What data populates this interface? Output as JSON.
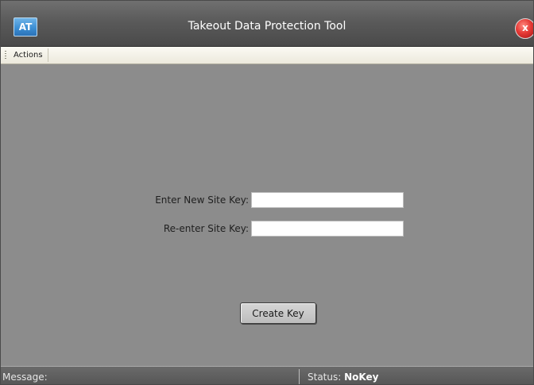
{
  "window": {
    "title": "Takeout Data Protection Tool",
    "logo_text": "AT",
    "close_label": "x"
  },
  "menu": {
    "items": [
      {
        "label": "Actions"
      }
    ]
  },
  "form": {
    "new_key_label": "Enter New Site Key:",
    "new_key_value": "",
    "reenter_key_label": "Re-enter Site Key:",
    "reenter_key_value": "",
    "create_button_label": "Create Key"
  },
  "status_bar": {
    "message_label": "Message:",
    "message_value": "",
    "status_label": "Status:",
    "status_value": "NoKey"
  },
  "colors": {
    "background": "#8c8c8c",
    "titlebar": "#5a5a5a",
    "logo": "#3d8fd4",
    "close": "#e53935"
  },
  "icons": {
    "logo": "app-logo-icon",
    "close": "close-icon",
    "grip": "toolbar-grip-icon"
  }
}
